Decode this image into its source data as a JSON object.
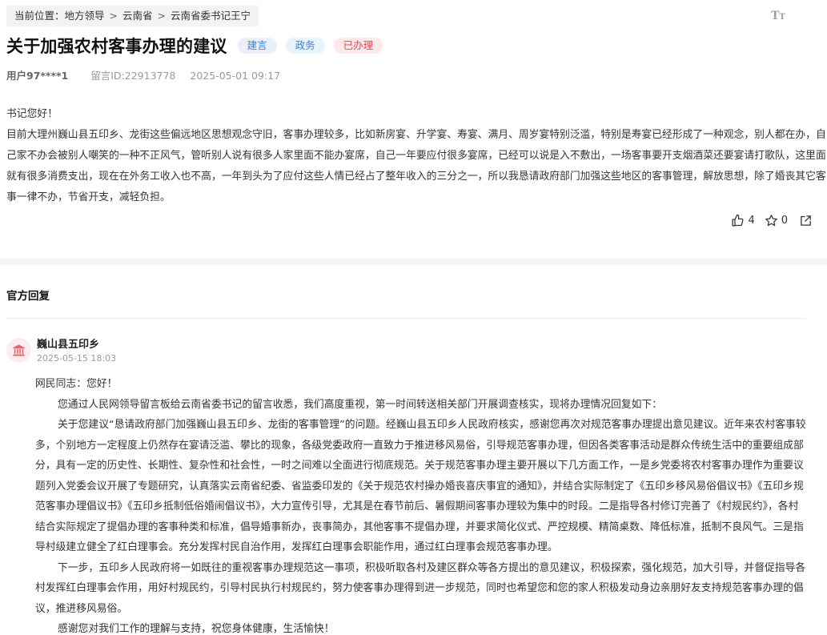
{
  "breadcrumb": {
    "prefix": "当前位置：",
    "items": [
      "地方领导",
      "云南省",
      "云南省委书记王宁"
    ],
    "separator": ">"
  },
  "font_toggle_icon": "font-size-icon",
  "message": {
    "title": "关于加强农村客事办理的建议",
    "tags": [
      "建言",
      "政务",
      "已办理"
    ],
    "tag_colors": [
      "#4d7ac9",
      "#3a86c8",
      "#e14b54"
    ],
    "user": "用户97****1",
    "msg_id": "留言ID:22913778",
    "datetime": "2025-05-01 09:17",
    "paragraphs": [
      "书记您好！",
      "目前大理州巍山县五印乡、龙街这些偏远地区思想观念守旧，客事办理较多，比如新房宴、升学宴、寿宴、满月、周岁宴特别泛滥，特别是寿宴已经形成了一种观念，别人都在办，自己家不办会被别人嘲笑的一种不正风气，管听别人说有很多人家里面不能办宴席，自己一年要应付很多宴席，已经可以说是入不敷出，一场客事要开支烟酒菜还要宴请打歌队，这里面就有很多消费支出，现在在外务工收入也不高，一年到头为了应付这些人情已经占了整年收入的三分之一，所以我恳请政府部门加强这些地区的客事管理，解放思想，除了婚丧其它客事一律不办，节省开支，减轻负担。"
    ],
    "actions": {
      "like_count": "4",
      "favorite_count": "0",
      "like_icon": "thumbs-up-icon",
      "favorite_icon": "star-icon",
      "share_icon": "share-icon"
    }
  },
  "reply": {
    "heading": "官方回复",
    "org_icon": "government-building-icon",
    "org_name": "巍山县五印乡",
    "datetime": "2025-05-15 18:03",
    "greeting": "网民同志：您好！",
    "paragraphs": [
      "您通过人民网领导留言板给云南省委书记的留言收悉，我们高度重视，第一时间转送相关部门开展调查核实，现将办理情况回复如下：",
      "关于您建议“恳请政府部门加强巍山县五印乡、龙街的客事管理”的问题。经巍山县五印乡人民政府核实，感谢您再次对规范客事办理提出意见建议。近年来农村客事较多，个别地方一定程度上仍然存在宴请泛滥、攀比的现象，各级党委政府一直致力于推进移风易俗，引导规范客事办理，但因各类客事活动是群众传统生活中的重要组成部分，具有一定的历史性、长期性、复杂性和社会性，一时之间难以全面进行彻底规范。关于规范客事办理主要开展以下几方面工作，一是乡党委将农村客事办理作为重要议题列入党委会议开展了专题研究，认真落实云南省纪委、省监委印发的《关于规范农村操办婚丧喜庆事宜的通知》，并结合实际制定了《五印乡移风易俗倡议书》《五印乡规范客事办理倡议书》《五印乡抵制低俗婚闹倡议书》，大力宣传引导，尤其是在春节前后、暑假期间客事办理较为集中的时段。二是指导各村修订完善了《村规民约》，各村结合实际规定了提倡办理的客事种类和标准，倡导婚事新办，丧事简办，其他客事不提倡办理，并要求简化仪式、严控规模、精简桌数、降低标准，抵制不良风气。三是指导村级建立健全了红白理事会。充分发挥村民自治作用，发挥红白理事会职能作用，通过红白理事会规范客事办理。",
      "下一步，五印乡人民政府将一如既往的重视客事办理规范这一事项，积极听取各村及建区群众等各方提出的意见建议，积极探索，强化规范，加大引导，并督促指导各村发挥红白理事会作用，用好村规民约，引导村民执行村规民约，努力使客事办理得到进一步规范，同时也希望您和您的家人积极发动身边亲朋好友支持规范客事办理的倡议，推进移风易俗。",
      "感谢您对我们工作的理解与支持，祝您身体健康，生活愉快！"
    ]
  }
}
